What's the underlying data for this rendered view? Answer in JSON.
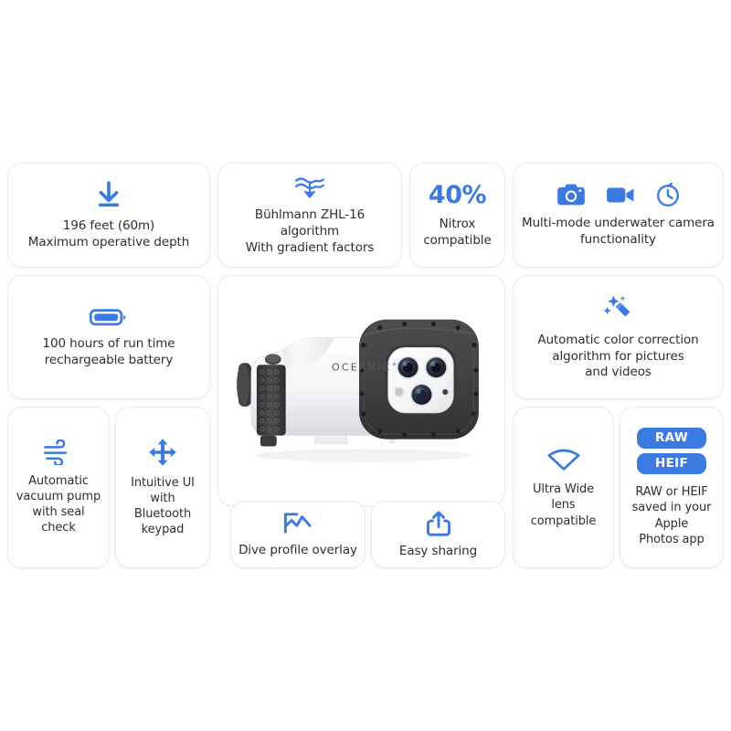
{
  "theme": {
    "accent": "#3b7ae0",
    "card_bg": "#ffffff",
    "card_border": "#e9e9ea",
    "page_bg": "#ffffff",
    "text": "#2e2e30"
  },
  "cards": [
    {
      "id": "max-depth",
      "icon": "download-arrow-icon",
      "label": "196 feet (60m)\nMaximum operative depth"
    },
    {
      "id": "algorithm",
      "icon": "waves-descent-icon",
      "label": "Bühlmann ZHL-16\nalgorithm\nWith gradient factors"
    },
    {
      "id": "nitrox",
      "icon": null,
      "stat": "40%",
      "label": "Nitrox\ncompatible"
    },
    {
      "id": "camera-modes",
      "icons": [
        "photo-camera-icon",
        "video-camera-icon",
        "timer-icon"
      ],
      "label": "Multi-mode underwater camera\nfunctionality"
    },
    {
      "id": "battery",
      "icon": "battery-full-icon",
      "label": "100 hours of run time\nrechargeable battery"
    },
    {
      "id": "color-correction",
      "icon": "magic-wand-icon",
      "label": "Automatic color correction\nalgorithm for pictures\nand videos"
    },
    {
      "id": "vacuum-pump",
      "icon": "wind-icon",
      "label": "Automatic\nvacuum pump\nwith seal check"
    },
    {
      "id": "intuitive-ui",
      "icon": "four-way-arrows-icon",
      "label": "Intuitive UI\nwith\nBluetooth\nkeypad"
    },
    {
      "id": "dive-profile",
      "icon": "dive-profile-chart-icon",
      "label": "Dive profile overlay"
    },
    {
      "id": "easy-sharing",
      "icon": "share-icon",
      "label": "Easy sharing"
    },
    {
      "id": "ultra-wide",
      "icon": "ultra-wide-lens-icon",
      "label": "Ultra Wide\nlens\ncompatible"
    },
    {
      "id": "raw-heif",
      "badges": [
        "RAW",
        "HEIF"
      ],
      "label": "RAW or HEIF\nsaved in your\nApple\nPhotos app"
    }
  ],
  "product": {
    "brand": "OCEANIC",
    "brand_superscript": "+",
    "alt": "underwater smartphone camera housing"
  }
}
